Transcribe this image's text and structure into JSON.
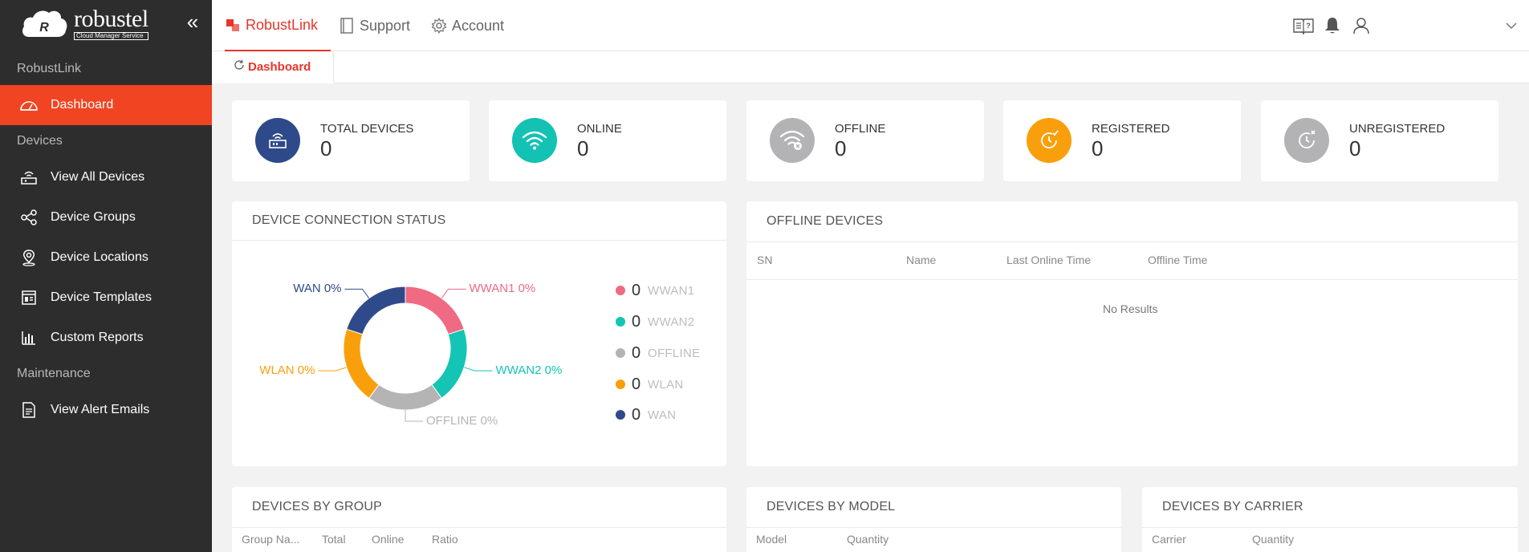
{
  "brand": {
    "logo_word": "robustel",
    "logo_sub": "Cloud Manager Service",
    "logo_mark": "R"
  },
  "sidebar": {
    "sections": [
      {
        "label": "RobustLink"
      },
      {
        "label": "Devices"
      },
      {
        "label": "Maintenance"
      }
    ],
    "items": [
      {
        "label": "Dashboard",
        "icon": "dashboard-gauge-icon"
      },
      {
        "label": "View All Devices",
        "icon": "router-icon"
      },
      {
        "label": "Device Groups",
        "icon": "share-nodes-icon"
      },
      {
        "label": "Device Locations",
        "icon": "location-pin-icon"
      },
      {
        "label": "Device Templates",
        "icon": "template-icon"
      },
      {
        "label": "Custom Reports",
        "icon": "bar-chart-icon"
      },
      {
        "label": "View Alert Emails",
        "icon": "document-icon"
      }
    ]
  },
  "topbar": {
    "tabs": [
      {
        "label": "RobustLink",
        "icon": "robustlink-icon"
      },
      {
        "label": "Support",
        "icon": "book-icon"
      },
      {
        "label": "Account",
        "icon": "gear-icon"
      }
    ],
    "right_icons": [
      "manual-book-icon",
      "bell-icon",
      "user-icon",
      "chevron-down-icon"
    ]
  },
  "page_tab": {
    "label": "Dashboard",
    "icon": "refresh-icon"
  },
  "stats": [
    {
      "label": "TOTAL DEVICES",
      "value": "0",
      "color": "#2f4a8a",
      "icon": "router-icon"
    },
    {
      "label": "ONLINE",
      "value": "0",
      "color": "#13c2b3",
      "icon": "wifi-icon"
    },
    {
      "label": "OFFLINE",
      "value": "0",
      "color": "#b3b3b5",
      "icon": "wifi-off-icon"
    },
    {
      "label": "REGISTERED",
      "value": "0",
      "color": "#fa9f0c",
      "icon": "clock-check-icon"
    },
    {
      "label": "UNREGISTERED",
      "value": "0",
      "color": "#b3b3b5",
      "icon": "clock-x-icon"
    }
  ],
  "connection_status": {
    "title": "DEVICE CONNECTION STATUS",
    "chart_data": {
      "type": "pie",
      "categories": [
        "WWAN1",
        "WWAN2",
        "OFFLINE",
        "WLAN",
        "WAN"
      ],
      "values": [
        0,
        0,
        0,
        0,
        0
      ],
      "slice_labels": [
        "WWAN1 0%",
        "WWAN2 0%",
        "OFFLINE 0%",
        "WLAN 0%",
        "WAN 0%"
      ],
      "colors": [
        "#ef6a82",
        "#14c4b4",
        "#b4b4b4",
        "#fa9f0c",
        "#2f4a8a"
      ],
      "legend_placement": "right"
    }
  },
  "offline_devices": {
    "title": "OFFLINE DEVICES",
    "columns": [
      "SN",
      "Name",
      "Last Online Time",
      "Offline Time"
    ],
    "empty_text": "No Results"
  },
  "by_group": {
    "title": "DEVICES BY GROUP",
    "columns": [
      "Group Na...",
      "Total",
      "Online",
      "Ratio"
    ]
  },
  "by_model": {
    "title": "DEVICES BY MODEL",
    "columns": [
      "Model",
      "Quantity"
    ]
  },
  "by_carrier": {
    "title": "DEVICES BY CARRIER",
    "columns": [
      "Carrier",
      "Quantity"
    ]
  }
}
